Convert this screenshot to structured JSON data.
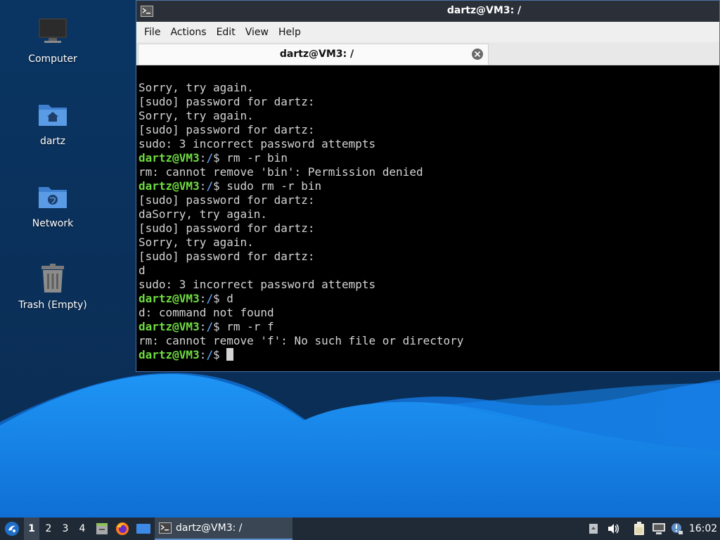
{
  "desktop": {
    "icons": [
      {
        "label": "Computer",
        "icon": "computer-icon"
      },
      {
        "label": "dartz",
        "icon": "home-folder-icon"
      },
      {
        "label": "Network",
        "icon": "network-folder-icon"
      },
      {
        "label": "Trash (Empty)",
        "icon": "trash-icon"
      }
    ]
  },
  "terminal": {
    "window_title": "dartz@VM3: /",
    "menu": [
      "File",
      "Actions",
      "Edit",
      "View",
      "Help"
    ],
    "tab_title": "dartz@VM3: /",
    "prompt_user": "dartz@VM3",
    "prompt_path": "/",
    "lines": [
      {
        "type": "out",
        "text": "Sorry, try again."
      },
      {
        "type": "out",
        "text": "[sudo] password for dartz:"
      },
      {
        "type": "out",
        "text": "Sorry, try again."
      },
      {
        "type": "out",
        "text": "[sudo] password for dartz:"
      },
      {
        "type": "out",
        "text": "sudo: 3 incorrect password attempts"
      },
      {
        "type": "cmd",
        "text": "rm -r bin"
      },
      {
        "type": "out",
        "text": "rm: cannot remove 'bin': Permission denied"
      },
      {
        "type": "cmd",
        "text": "sudo rm -r bin"
      },
      {
        "type": "out",
        "text": "[sudo] password for dartz:"
      },
      {
        "type": "out",
        "text": "daSorry, try again."
      },
      {
        "type": "out",
        "text": "[sudo] password for dartz:"
      },
      {
        "type": "out",
        "text": "Sorry, try again."
      },
      {
        "type": "out",
        "text": "[sudo] password for dartz:"
      },
      {
        "type": "out",
        "text": "d"
      },
      {
        "type": "out",
        "text": "sudo: 3 incorrect password attempts"
      },
      {
        "type": "cmd",
        "text": "d"
      },
      {
        "type": "out",
        "text": "d: command not found"
      },
      {
        "type": "cmd",
        "text": "rm -r f"
      },
      {
        "type": "out",
        "text": "rm: cannot remove 'f': No such file or directory"
      },
      {
        "type": "cmd",
        "text": ""
      }
    ]
  },
  "taskbar": {
    "workspaces": [
      "1",
      "2",
      "3",
      "4"
    ],
    "active_workspace": "1",
    "task_label": "dartz@VM3: /",
    "clock": "16:02",
    "icons": [
      "start-menu-icon",
      "file-manager-icon",
      "firefox-icon",
      "show-desktop-icon",
      "clipboard-tray-icon",
      "volume-icon",
      "battery-icon",
      "network-tray-icon",
      "update-notifier-icon"
    ]
  },
  "colors": {
    "prompt_user": "#6edb3f",
    "prompt_path": "#5f9be8",
    "terminal_bg": "#000000",
    "wallpaper_dark": "#0a2f56",
    "wallpaper_light": "#1b8df0",
    "taskbar_bg": "#202a36"
  }
}
